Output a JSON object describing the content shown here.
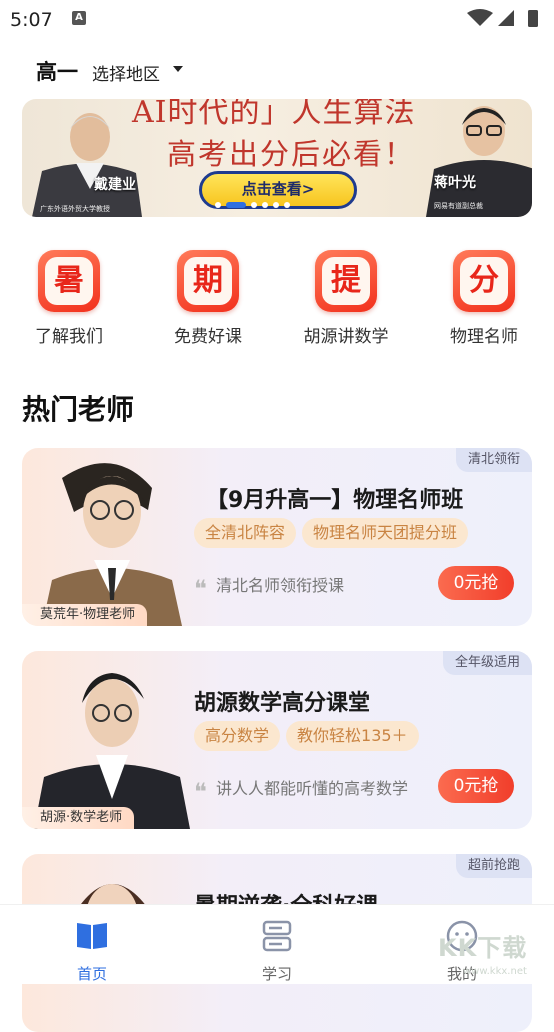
{
  "status": {
    "time": "5:07",
    "notif": "A"
  },
  "header": {
    "grade": "高一",
    "region": "选择地区"
  },
  "banner": {
    "line1": "AI时代的」人生算法",
    "line2": "高考出分后必看！",
    "cta": "点击查看>",
    "person_left": "戴建业",
    "person_left_caption": "广东外语外贸大学教授",
    "person_right": "蒋叶光",
    "person_right_caption": "网易有道副总裁"
  },
  "quick_links": [
    {
      "glyph": "暑",
      "label": "了解我们"
    },
    {
      "glyph": "期",
      "label": "免费好课"
    },
    {
      "glyph": "提",
      "label": "胡源讲数学"
    },
    {
      "glyph": "分",
      "label": "物理名师"
    }
  ],
  "section_title": "热门老师",
  "courses": [
    {
      "tag": "清北领衔",
      "title": "【9月升高一】物理名师班",
      "chips": [
        "全清北阵容",
        "物理名师天团提分班"
      ],
      "quote": "清北名师领衔授课",
      "button": "0元抢",
      "teacher": "莫荒年·物理老师"
    },
    {
      "tag": "全年级适用",
      "title": "胡源数学高分课堂",
      "chips": [
        "高分数学",
        "教你轻松135＋"
      ],
      "quote": "讲人人都能听懂的高考数学",
      "button": "0元抢",
      "teacher": "胡源·数学老师"
    },
    {
      "tag": "超前抢跑",
      "title": "暑期逆袭·全科好课",
      "chips": [],
      "quote": "",
      "button": "",
      "teacher": ""
    }
  ],
  "tabbar": [
    {
      "label": "首页",
      "icon": "book-icon",
      "active": true
    },
    {
      "label": "学习",
      "icon": "study-icon",
      "active": false
    },
    {
      "label": "我的",
      "icon": "profile-icon",
      "active": false
    }
  ],
  "watermark": {
    "text": "KK下载",
    "url": "www.kkx.net"
  },
  "colors": {
    "accent": "#2f6fe0",
    "cta_red": "#f13e2b",
    "banner_red": "#c0362c"
  }
}
